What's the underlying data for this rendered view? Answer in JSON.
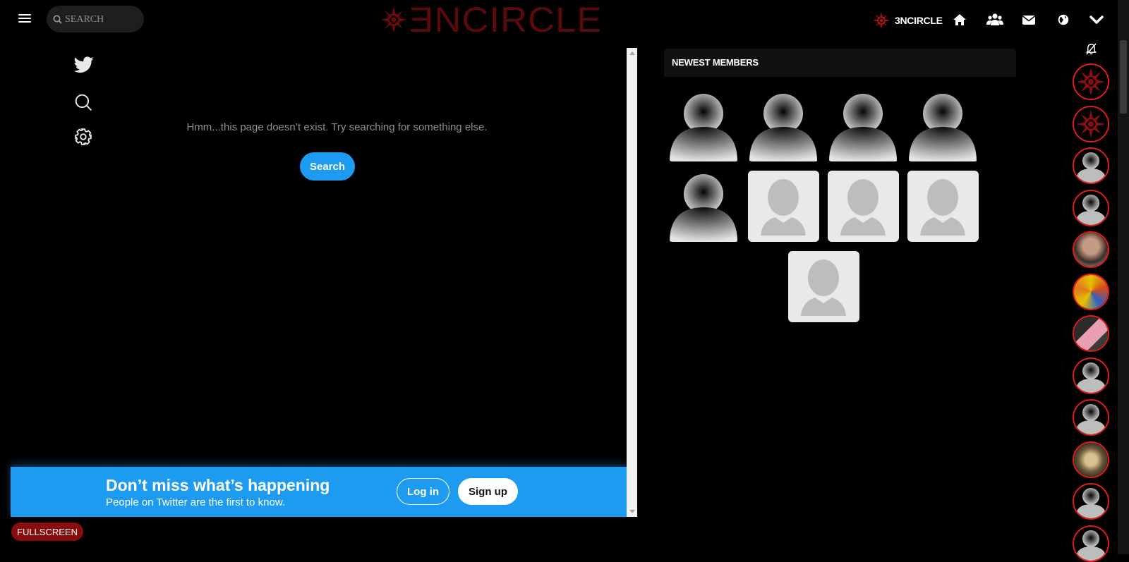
{
  "topbar": {
    "search_placeholder": "SEARCH",
    "logo_text": "ƎNCIRCLE",
    "brand_label": "3NCIRCLE",
    "icons": [
      "menu-icon",
      "search-icon",
      "home-icon",
      "groups-icon",
      "mail-icon",
      "globe-icon",
      "chevron-down-icon"
    ]
  },
  "twitter": {
    "message": "Hmm...this page doesn’t exist. Try searching for something else.",
    "search_label": "Search",
    "banner_title": "Don’t miss what’s happening",
    "banner_sub": "People on Twitter are the first to know.",
    "login_label": "Log in",
    "signup_label": "Sign up",
    "accent": "#1d9bf0"
  },
  "fullscreen_label": "FULLSCREEN",
  "members": {
    "title": "NEWEST MEMBERS",
    "tiles": [
      "dark",
      "dark",
      "dark",
      "dark",
      "dark",
      "light",
      "light",
      "light",
      "light"
    ]
  },
  "rail": {
    "avatars": [
      "logo",
      "logo",
      "default",
      "default",
      "photo-man",
      "photo-colorful",
      "photo-pink",
      "default",
      "default",
      "photo-armor",
      "default",
      "default"
    ],
    "accent": "#e31b1b"
  }
}
